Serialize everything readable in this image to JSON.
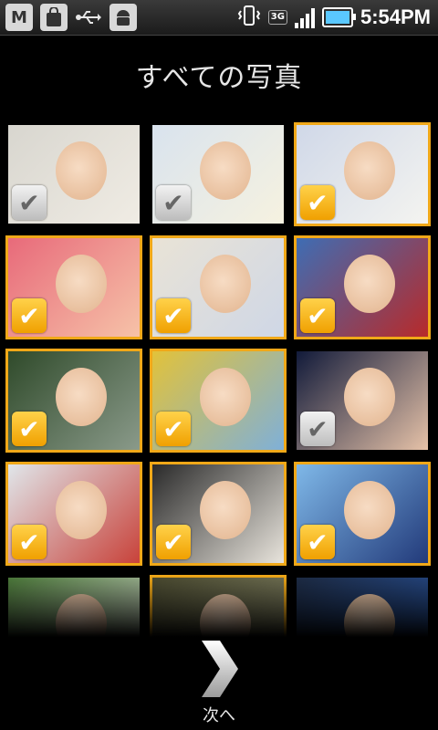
{
  "status_bar": {
    "left_icons": [
      "gmail-icon",
      "shopping-bag-icon",
      "usb-icon",
      "android-debug-icon"
    ],
    "right_icons": [
      "vibrate-icon",
      "3g-icon",
      "signal-icon",
      "battery-icon"
    ],
    "network_label": "3G",
    "time": "5:54PM"
  },
  "screen_title": "すべての写真",
  "photos": [
    {
      "selected": false
    },
    {
      "selected": false
    },
    {
      "selected": true
    },
    {
      "selected": true
    },
    {
      "selected": true
    },
    {
      "selected": true
    },
    {
      "selected": true
    },
    {
      "selected": true
    },
    {
      "selected": false
    },
    {
      "selected": true
    },
    {
      "selected": true
    },
    {
      "selected": true
    },
    {
      "selected": false
    },
    {
      "selected": true
    },
    {
      "selected": false
    }
  ],
  "next_button": {
    "label": "次へ"
  },
  "colors": {
    "accent": "#f0a818",
    "background": "#000000"
  }
}
